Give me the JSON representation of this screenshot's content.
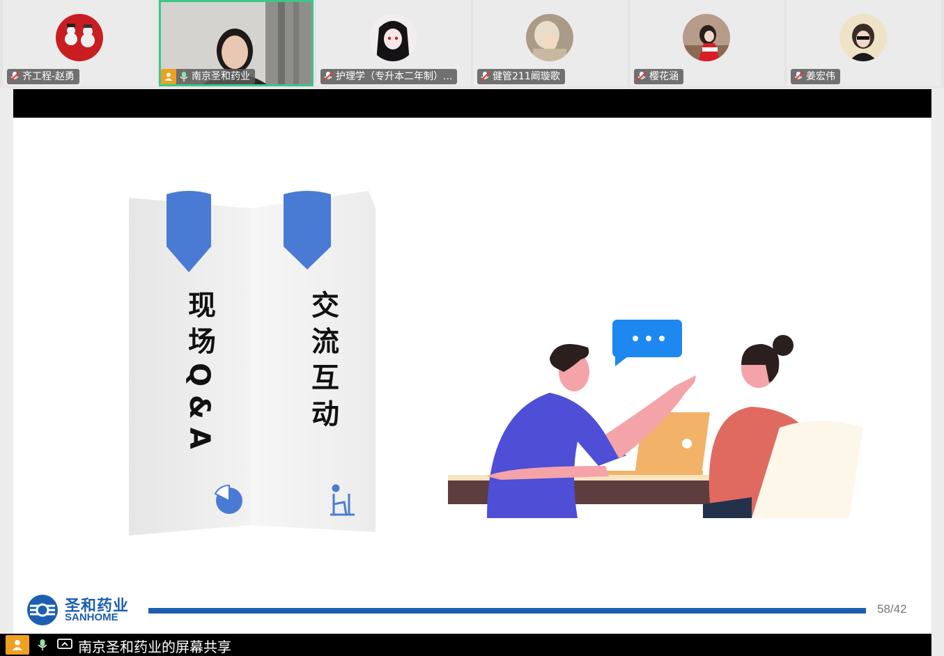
{
  "participants": [
    {
      "name": "齐工程-赵勇",
      "muted": true
    },
    {
      "name": "南京圣和药业",
      "muted": false,
      "host": true,
      "active": true
    },
    {
      "name": "护理学（专升本二年制）...",
      "muted": true
    },
    {
      "name": "健管211阚璇歌",
      "muted": true
    },
    {
      "name": "樱花涵",
      "muted": true
    },
    {
      "name": "姜宏伟",
      "muted": true
    }
  ],
  "slide": {
    "bookmark_left_text": "现场Q&A",
    "bookmark_right_text": "交流互动",
    "logo_cn": "圣和药业",
    "logo_en": "SANHOME",
    "page_number": "58/42",
    "bubble_text": "• • •"
  },
  "share_bar": {
    "label": "南京圣和药业的屏幕共享"
  },
  "colors": {
    "active_border": "#3cc68a",
    "bookmark_blue": "#4a7bd4",
    "progress_blue": "#1c5fb0"
  }
}
